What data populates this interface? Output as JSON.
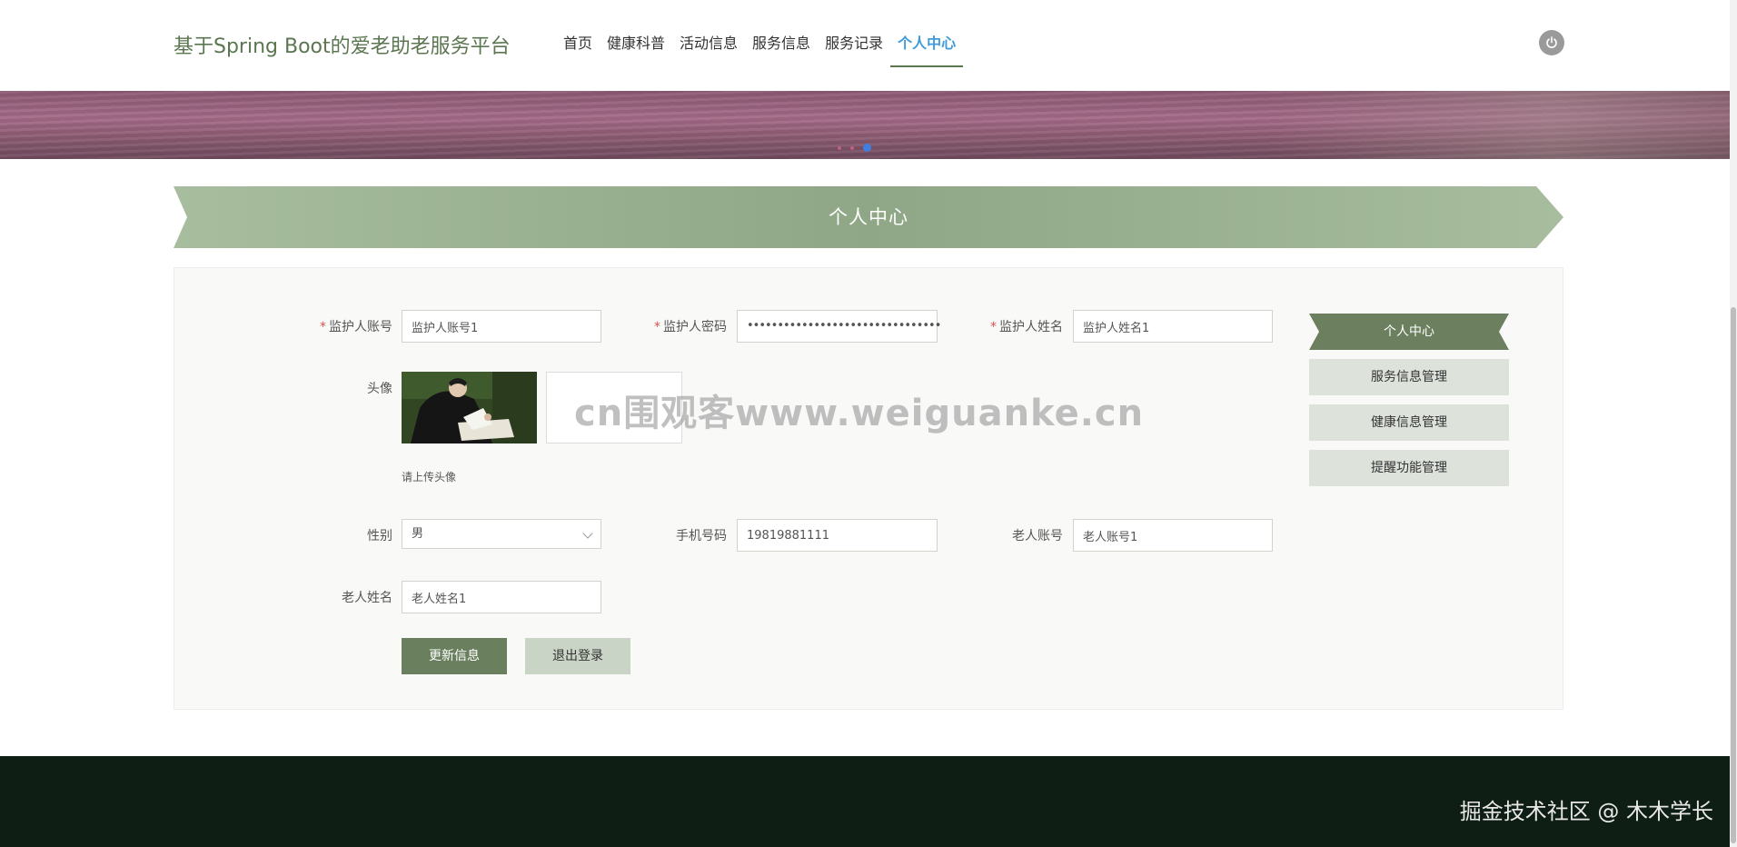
{
  "header": {
    "site_title": "基于Spring Boot的爱老助老服务平台",
    "nav": [
      "首页",
      "健康科普",
      "活动信息",
      "服务信息",
      "服务记录",
      "个人中心"
    ],
    "active_nav": "个人中心"
  },
  "banner": {
    "slide_count": 3,
    "active_slide": 3
  },
  "page_title": "个人中心",
  "form": {
    "guardian_account": {
      "label": "监护人账号",
      "required": true,
      "value": "监护人账号1"
    },
    "guardian_password": {
      "label": "监护人密码",
      "required": true,
      "value": "••••••••••••••••••••••••••••••••"
    },
    "guardian_name": {
      "label": "监护人姓名",
      "required": true,
      "value": "监护人姓名1"
    },
    "avatar": {
      "label": "头像",
      "hint": "请上传头像"
    },
    "gender": {
      "label": "性别",
      "value": "男"
    },
    "phone": {
      "label": "手机号码",
      "value": "19819881111"
    },
    "elder_account": {
      "label": "老人账号",
      "value": "老人账号1"
    },
    "elder_name": {
      "label": "老人姓名",
      "value": "老人姓名1"
    },
    "update_button": "更新信息",
    "logout_button": "退出登录"
  },
  "side_menu": {
    "active": "个人中心",
    "items": [
      "服务信息管理",
      "健康信息管理",
      "提醒功能管理"
    ]
  },
  "watermark": "cn围观客www.weiguanke.cn",
  "footer": {
    "text": "掘金技术社区 @ 木木学长"
  },
  "colors": {
    "primary": "#6a7f5e",
    "accent": "#3f9bd9",
    "footer_bg": "#0f1e14",
    "banner": "#a46a88"
  }
}
